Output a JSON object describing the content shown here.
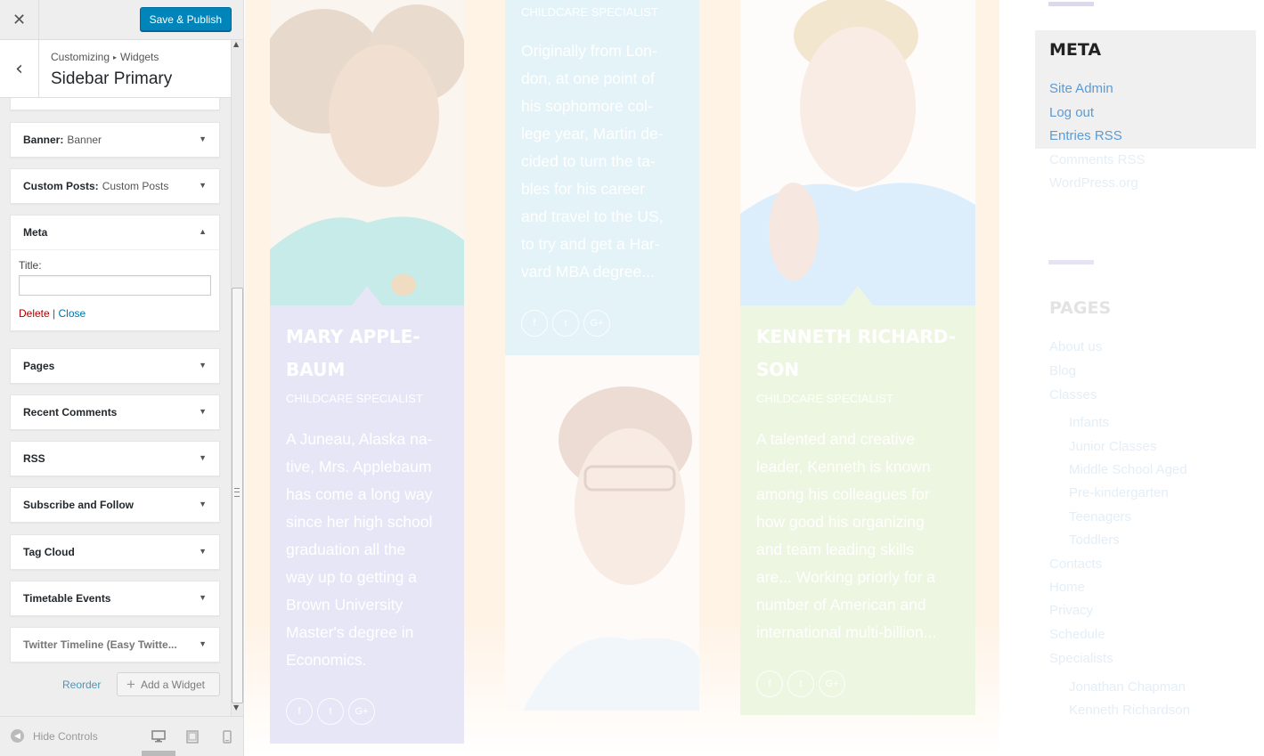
{
  "toolbar": {
    "close_glyph": "✕",
    "save_label": "Save & Publish"
  },
  "section": {
    "back_glyph": "‹",
    "crumb_root": "Customizing",
    "crumb_sep": "▸",
    "crumb_leaf": "Widgets",
    "title": "Sidebar Primary"
  },
  "widgets": [
    {
      "name": "Banner:",
      "sub": "Banner"
    },
    {
      "name": "Custom Posts:",
      "sub": "Custom Posts"
    },
    {
      "name": "Meta",
      "sub": "",
      "expanded": true,
      "title_label": "Title:",
      "title_value": "",
      "delete_label": "Delete",
      "sep": " | ",
      "close_label": "Close"
    },
    {
      "name": "Pages",
      "sub": ""
    },
    {
      "name": "Recent Comments",
      "sub": ""
    },
    {
      "name": "RSS",
      "sub": ""
    },
    {
      "name": "Subscribe and Follow",
      "sub": ""
    },
    {
      "name": "Tag Cloud",
      "sub": ""
    },
    {
      "name": "Timetable Events",
      "sub": ""
    },
    {
      "name": "Twitter Timeline (Easy Twitte...",
      "sub": ""
    }
  ],
  "actions": {
    "reorder_label": "Reorder",
    "add_label": "Add a Widget",
    "add_glyph": "+"
  },
  "footer": {
    "hide_label": "Hide Controls"
  },
  "preview": {
    "team": [
      {
        "name_line1": "MARY APPLE-",
        "name_line2": "BAUM",
        "role": "CHILDCARE SPECIALIST",
        "bio": [
          "A Juneau, Alaska na-",
          "tive, Mrs. Applebaum",
          "has come a long way",
          "since her high school",
          "graduation all the",
          "way up to getting a",
          "Brown University",
          "Master's degree in",
          "Economics."
        ]
      },
      {
        "name_line1": "",
        "name_line2": "",
        "role": "CHILDCARE SPECIALIST",
        "bio": [
          "Originally from Lon-",
          "don, at one point of",
          "his sophomore col-",
          "lege year, Martin de-",
          "cided to turn the ta-",
          "bles for his career",
          "and travel to the US,",
          "to try and get a Har-",
          "vard MBA degree..."
        ]
      },
      {
        "name_line1": "KENNETH RICHARD-",
        "name_line2": "SON",
        "role": "CHILDCARE SPECIALIST",
        "bio": [
          "A talented and creative",
          "leader, Kenneth is known",
          "among his colleagues for",
          "how good his organizing",
          "and team leading skills",
          "are... Working priorly for a",
          "number of American and",
          "international multi-billion..."
        ]
      }
    ],
    "social": [
      "f",
      "t",
      "G+"
    ],
    "meta": {
      "title": "META",
      "links": [
        "Site Admin",
        "Log out",
        "Entries RSS"
      ],
      "faint_links": [
        "Comments RSS",
        "WordPress.org"
      ]
    },
    "pages": {
      "title": "PAGES",
      "items": [
        "About us",
        "Blog",
        "Classes"
      ],
      "sub_items": [
        "Infants",
        "Junior Classes",
        "Middle School Aged",
        "Pre-kindergarten",
        "Teenagers",
        "Toddlers"
      ],
      "items2": [
        "Contacts",
        "Home",
        "Privacy",
        "Schedule",
        "Specialists"
      ],
      "sub_items2": [
        "Jonathan Chapman",
        "Kenneth Richardson"
      ]
    }
  },
  "colors": {
    "accent": "#0085ba",
    "card_purple": "#e7e6f6",
    "card_blue": "#e3f3f8",
    "card_green": "#edf6e1",
    "link": "#5b9bd5"
  }
}
